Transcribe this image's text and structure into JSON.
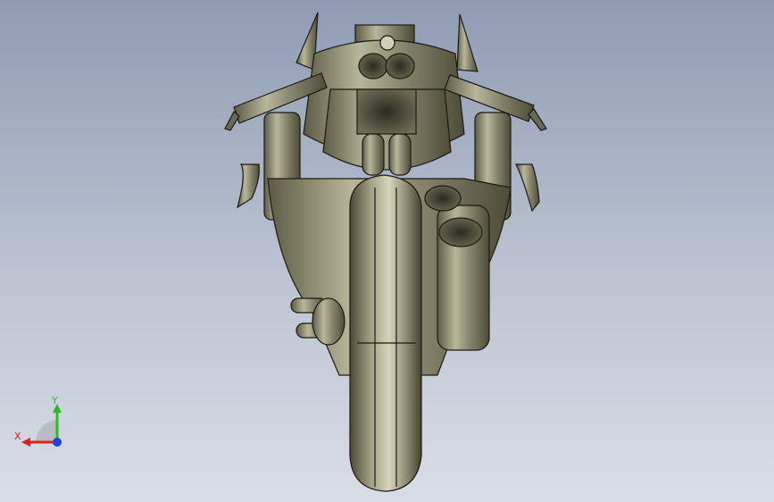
{
  "viewport": {
    "colors": {
      "top": "#8e9bb3",
      "bottom": "#d9dde5",
      "model": "#8f8d73",
      "edges": "#1a1a14"
    }
  },
  "triad": {
    "x_label": "X",
    "y_label": "Y",
    "x_color": "#e02020",
    "y_color": "#20c020",
    "z_color": "#2040e0"
  }
}
